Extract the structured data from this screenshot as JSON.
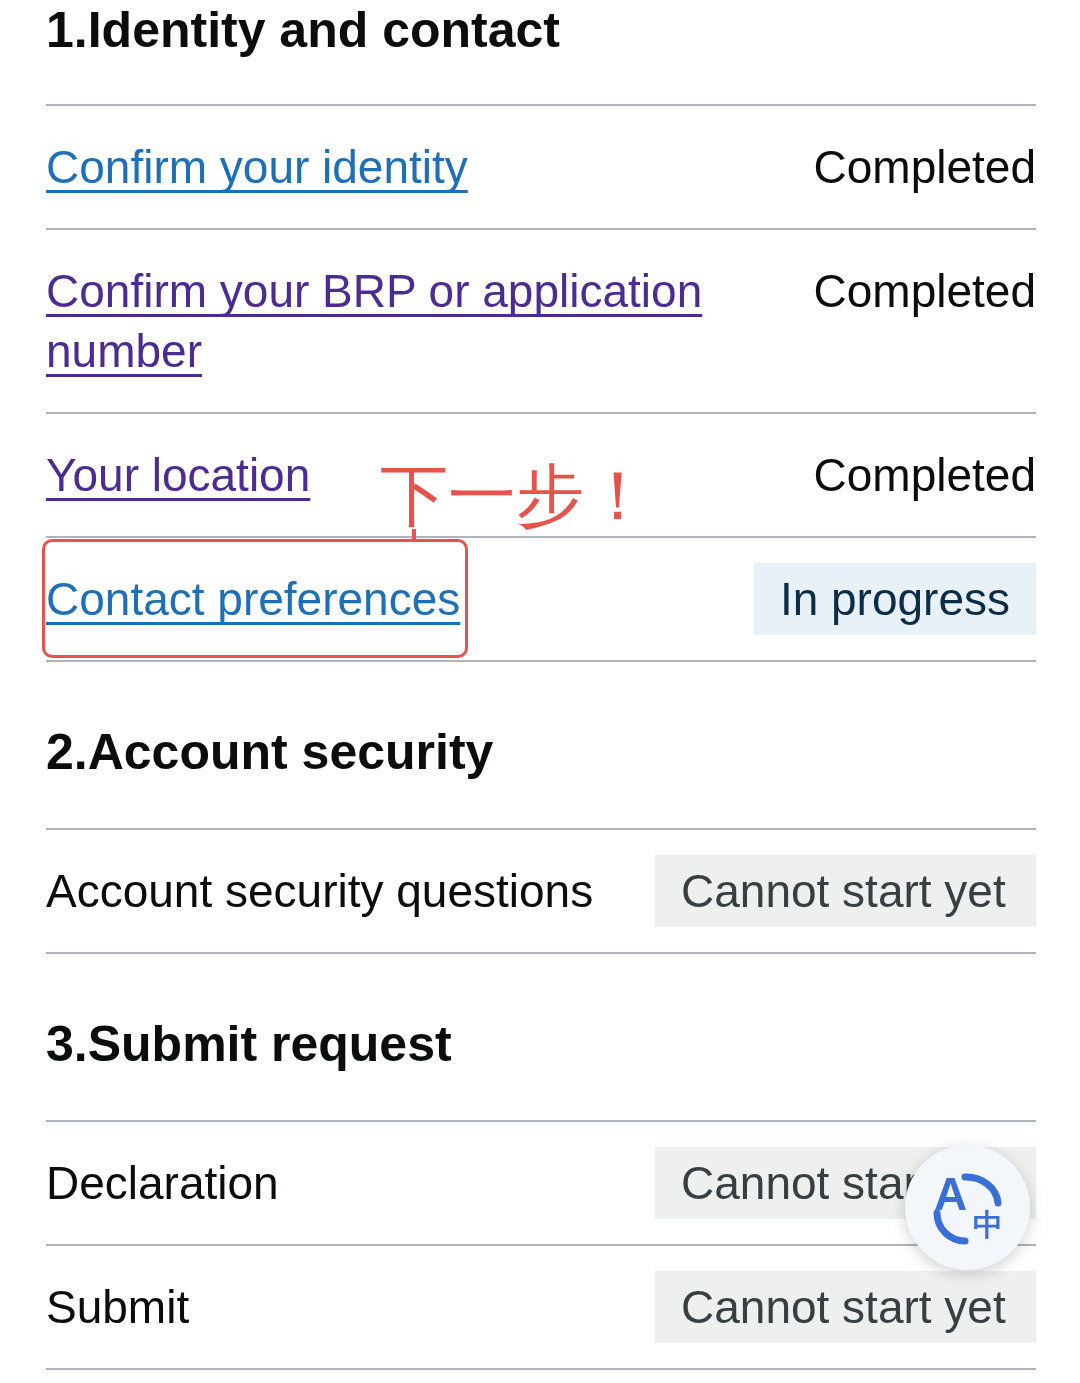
{
  "sections": [
    {
      "title": "1.Identity and contact",
      "tasks": [
        {
          "kind": "link",
          "label": "Confirm your identity",
          "visited": false,
          "highlighted": false,
          "status": {
            "kind": "completed",
            "text": "Completed"
          }
        },
        {
          "kind": "link",
          "label": "Confirm your BRP or application number",
          "visited": true,
          "highlighted": false,
          "status": {
            "kind": "completed",
            "text": "Completed"
          }
        },
        {
          "kind": "link",
          "label": "Your location",
          "visited": true,
          "highlighted": false,
          "status": {
            "kind": "completed",
            "text": "Completed"
          }
        },
        {
          "kind": "link",
          "label": "Contact preferences",
          "visited": false,
          "highlighted": true,
          "callout": "下一步！",
          "status": {
            "kind": "in_progress",
            "text": "In progress"
          }
        }
      ]
    },
    {
      "title": "2.Account security",
      "tasks": [
        {
          "kind": "text",
          "label": "Account security questions",
          "status": {
            "kind": "cannot_start",
            "text": "Cannot start yet"
          }
        }
      ]
    },
    {
      "title": "3.Submit request",
      "tasks": [
        {
          "kind": "text",
          "label": "Declaration",
          "status": {
            "kind": "cannot_start",
            "text": "Cannot star"
          }
        },
        {
          "kind": "text",
          "label": "Submit",
          "status": {
            "kind": "cannot_start",
            "text": "Cannot start yet"
          }
        }
      ]
    }
  ],
  "translate_button": {
    "letter": "A",
    "character": "中"
  }
}
